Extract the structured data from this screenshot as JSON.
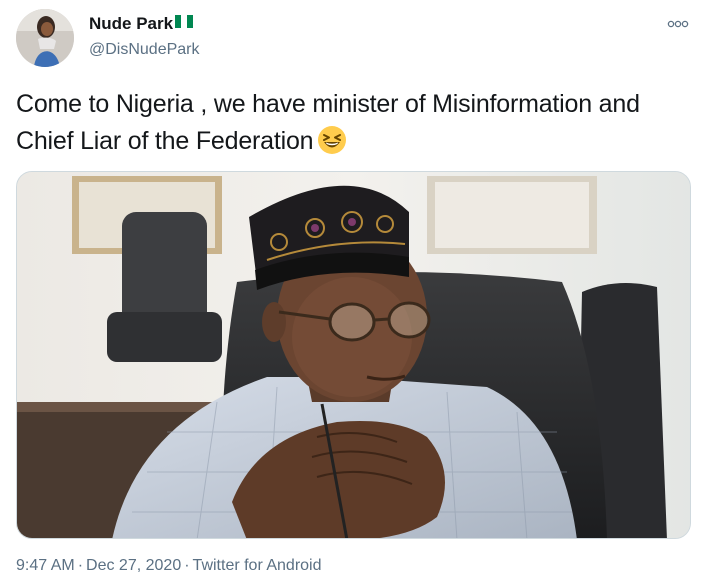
{
  "author": {
    "display_name": "Nude Park",
    "handle": "@DisNudePark",
    "flag": "nigeria-flag-icon"
  },
  "tweet": {
    "text": "Come to Nigeria , we have minister of Misinformation and Chief Liar of the Federation",
    "emoji": "grinning-squinting-face"
  },
  "meta": {
    "time": "9:47 AM",
    "separator": "·",
    "date": "Dec 27, 2020",
    "source": "Twitter for Android"
  },
  "icons": {
    "more": "more-options-icon"
  },
  "colors": {
    "text": "#14171a",
    "secondary": "#5b7083",
    "flag_green": "#008751",
    "border": "#cfd9de"
  }
}
